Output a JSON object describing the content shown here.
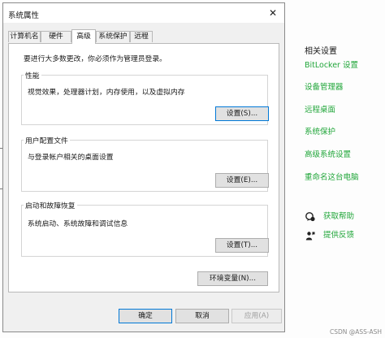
{
  "dialog": {
    "title": "系统属性",
    "close_glyph": "✕",
    "tabs": [
      {
        "label": "计算机名"
      },
      {
        "label": "硬件"
      },
      {
        "label": "高级"
      },
      {
        "label": "系统保护"
      },
      {
        "label": "远程"
      }
    ],
    "active_tab": "高级",
    "notice": "要进行大多数更改，你必须作为管理员登录。",
    "groups": {
      "performance": {
        "title": "性能",
        "desc": "视觉效果，处理器计划，内存使用，以及虚拟内存",
        "button": "设置(S)..."
      },
      "profiles": {
        "title": "用户配置文件",
        "desc": "与登录帐户相关的桌面设置",
        "button": "设置(E)..."
      },
      "startup": {
        "title": "启动和故障恢复",
        "desc": "系统启动、系统故障和调试信息",
        "button": "设置(T)..."
      }
    },
    "env_button": "环境变量(N)...",
    "ok": "确定",
    "cancel": "取消",
    "apply": "应用(A)"
  },
  "related": {
    "title": "相关设置",
    "links": [
      "BitLocker 设置",
      "设备管理器",
      "远程桌面",
      "系统保护",
      "高级系统设置",
      "重命名这台电脑"
    ],
    "help": "获取帮助",
    "feedback": "提供反馈"
  },
  "watermark": "CSDN @ASS-ASH",
  "colors": {
    "link": "#21a63a",
    "focus": "#0078d7"
  }
}
